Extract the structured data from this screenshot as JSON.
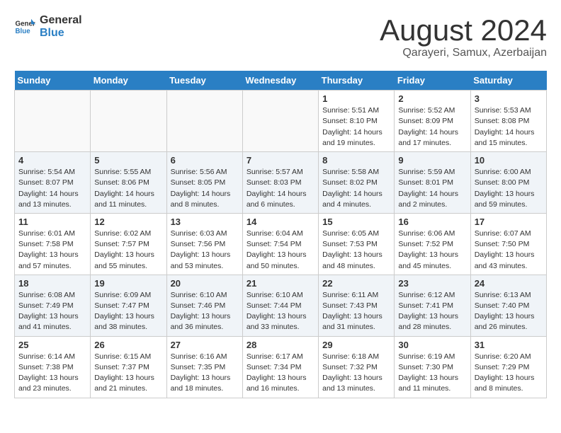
{
  "header": {
    "logo_general": "General",
    "logo_blue": "Blue",
    "month": "August 2024",
    "location": "Qarayeri, Samux, Azerbaijan"
  },
  "weekdays": [
    "Sunday",
    "Monday",
    "Tuesday",
    "Wednesday",
    "Thursday",
    "Friday",
    "Saturday"
  ],
  "weeks": [
    [
      {
        "day": "",
        "info": ""
      },
      {
        "day": "",
        "info": ""
      },
      {
        "day": "",
        "info": ""
      },
      {
        "day": "",
        "info": ""
      },
      {
        "day": "1",
        "info": "Sunrise: 5:51 AM\nSunset: 8:10 PM\nDaylight: 14 hours\nand 19 minutes."
      },
      {
        "day": "2",
        "info": "Sunrise: 5:52 AM\nSunset: 8:09 PM\nDaylight: 14 hours\nand 17 minutes."
      },
      {
        "day": "3",
        "info": "Sunrise: 5:53 AM\nSunset: 8:08 PM\nDaylight: 14 hours\nand 15 minutes."
      }
    ],
    [
      {
        "day": "4",
        "info": "Sunrise: 5:54 AM\nSunset: 8:07 PM\nDaylight: 14 hours\nand 13 minutes."
      },
      {
        "day": "5",
        "info": "Sunrise: 5:55 AM\nSunset: 8:06 PM\nDaylight: 14 hours\nand 11 minutes."
      },
      {
        "day": "6",
        "info": "Sunrise: 5:56 AM\nSunset: 8:05 PM\nDaylight: 14 hours\nand 8 minutes."
      },
      {
        "day": "7",
        "info": "Sunrise: 5:57 AM\nSunset: 8:03 PM\nDaylight: 14 hours\nand 6 minutes."
      },
      {
        "day": "8",
        "info": "Sunrise: 5:58 AM\nSunset: 8:02 PM\nDaylight: 14 hours\nand 4 minutes."
      },
      {
        "day": "9",
        "info": "Sunrise: 5:59 AM\nSunset: 8:01 PM\nDaylight: 14 hours\nand 2 minutes."
      },
      {
        "day": "10",
        "info": "Sunrise: 6:00 AM\nSunset: 8:00 PM\nDaylight: 13 hours\nand 59 minutes."
      }
    ],
    [
      {
        "day": "11",
        "info": "Sunrise: 6:01 AM\nSunset: 7:58 PM\nDaylight: 13 hours\nand 57 minutes."
      },
      {
        "day": "12",
        "info": "Sunrise: 6:02 AM\nSunset: 7:57 PM\nDaylight: 13 hours\nand 55 minutes."
      },
      {
        "day": "13",
        "info": "Sunrise: 6:03 AM\nSunset: 7:56 PM\nDaylight: 13 hours\nand 53 minutes."
      },
      {
        "day": "14",
        "info": "Sunrise: 6:04 AM\nSunset: 7:54 PM\nDaylight: 13 hours\nand 50 minutes."
      },
      {
        "day": "15",
        "info": "Sunrise: 6:05 AM\nSunset: 7:53 PM\nDaylight: 13 hours\nand 48 minutes."
      },
      {
        "day": "16",
        "info": "Sunrise: 6:06 AM\nSunset: 7:52 PM\nDaylight: 13 hours\nand 45 minutes."
      },
      {
        "day": "17",
        "info": "Sunrise: 6:07 AM\nSunset: 7:50 PM\nDaylight: 13 hours\nand 43 minutes."
      }
    ],
    [
      {
        "day": "18",
        "info": "Sunrise: 6:08 AM\nSunset: 7:49 PM\nDaylight: 13 hours\nand 41 minutes."
      },
      {
        "day": "19",
        "info": "Sunrise: 6:09 AM\nSunset: 7:47 PM\nDaylight: 13 hours\nand 38 minutes."
      },
      {
        "day": "20",
        "info": "Sunrise: 6:10 AM\nSunset: 7:46 PM\nDaylight: 13 hours\nand 36 minutes."
      },
      {
        "day": "21",
        "info": "Sunrise: 6:10 AM\nSunset: 7:44 PM\nDaylight: 13 hours\nand 33 minutes."
      },
      {
        "day": "22",
        "info": "Sunrise: 6:11 AM\nSunset: 7:43 PM\nDaylight: 13 hours\nand 31 minutes."
      },
      {
        "day": "23",
        "info": "Sunrise: 6:12 AM\nSunset: 7:41 PM\nDaylight: 13 hours\nand 28 minutes."
      },
      {
        "day": "24",
        "info": "Sunrise: 6:13 AM\nSunset: 7:40 PM\nDaylight: 13 hours\nand 26 minutes."
      }
    ],
    [
      {
        "day": "25",
        "info": "Sunrise: 6:14 AM\nSunset: 7:38 PM\nDaylight: 13 hours\nand 23 minutes."
      },
      {
        "day": "26",
        "info": "Sunrise: 6:15 AM\nSunset: 7:37 PM\nDaylight: 13 hours\nand 21 minutes."
      },
      {
        "day": "27",
        "info": "Sunrise: 6:16 AM\nSunset: 7:35 PM\nDaylight: 13 hours\nand 18 minutes."
      },
      {
        "day": "28",
        "info": "Sunrise: 6:17 AM\nSunset: 7:34 PM\nDaylight: 13 hours\nand 16 minutes."
      },
      {
        "day": "29",
        "info": "Sunrise: 6:18 AM\nSunset: 7:32 PM\nDaylight: 13 hours\nand 13 minutes."
      },
      {
        "day": "30",
        "info": "Sunrise: 6:19 AM\nSunset: 7:30 PM\nDaylight: 13 hours\nand 11 minutes."
      },
      {
        "day": "31",
        "info": "Sunrise: 6:20 AM\nSunset: 7:29 PM\nDaylight: 13 hours\nand 8 minutes."
      }
    ]
  ]
}
